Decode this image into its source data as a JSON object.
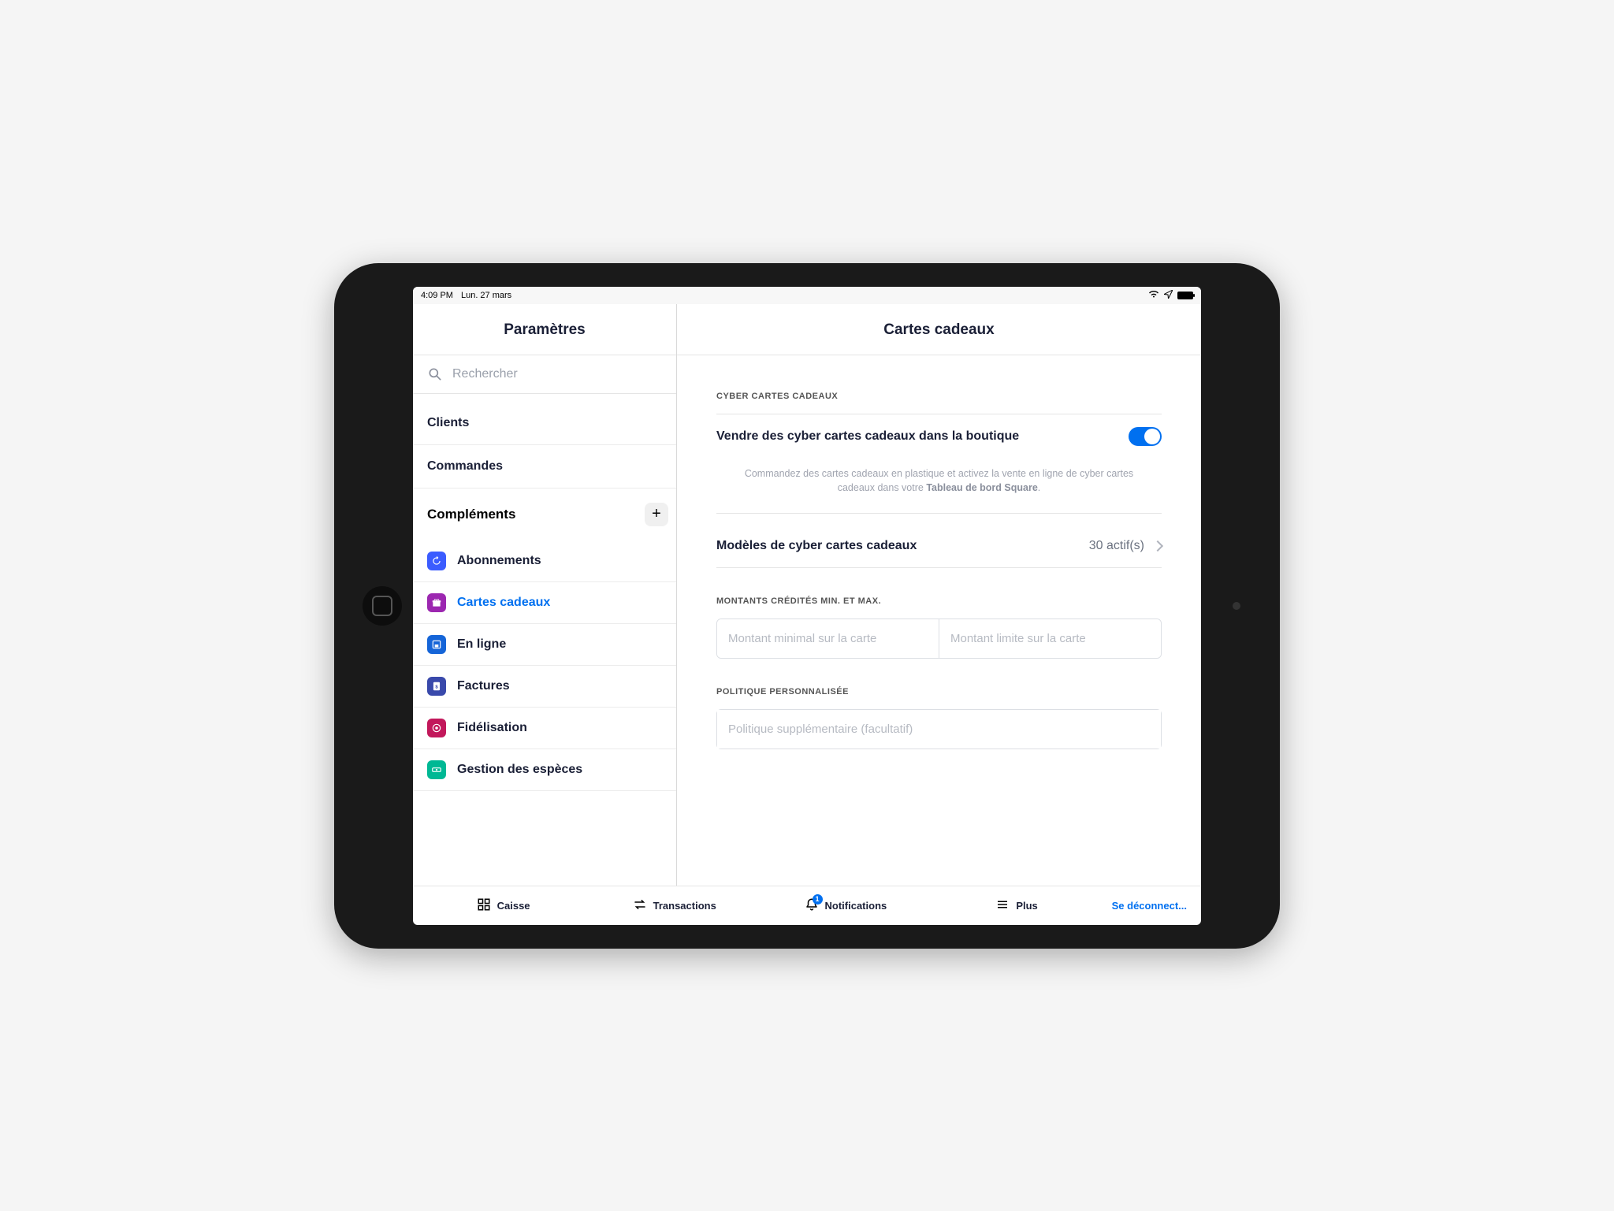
{
  "statusbar": {
    "time": "4:09 PM",
    "date": "Lun. 27 mars"
  },
  "sidebar": {
    "title": "Paramètres",
    "search_placeholder": "Rechercher",
    "top_items": [
      "Clients",
      "Commandes"
    ],
    "section": {
      "label": "Compléments"
    },
    "sub_items": [
      {
        "label": "Abonnements",
        "color": "#3b5cff",
        "icon": "refresh"
      },
      {
        "label": "Cartes cadeaux",
        "color": "#9c27b0",
        "icon": "gift",
        "active": true
      },
      {
        "label": "En ligne",
        "color": "#1565d8",
        "icon": "storefront"
      },
      {
        "label": "Factures",
        "color": "#3949ab",
        "icon": "invoice"
      },
      {
        "label": "Fidélisation",
        "color": "#c2185b",
        "icon": "loyalty"
      },
      {
        "label": "Gestion des espèces",
        "color": "#00b894",
        "icon": "cash"
      }
    ]
  },
  "main": {
    "title": "Cartes cadeaux",
    "section1_label": "CYBER CARTES CADEAUX",
    "toggle_label": "Vendre des cyber cartes cadeaux dans la boutique",
    "help_pre": "Commandez des cartes cadeaux en plastique et activez la vente en ligne de cyber cartes cadeaux dans votre ",
    "help_bold": "Tableau de bord Square",
    "models_label": "Modèles de cyber cartes cadeaux",
    "models_count": "30 actif(s)",
    "section2_label": "MONTANTS CRÉDITÉS MIN. ET MAX.",
    "min_placeholder": "Montant minimal sur la carte",
    "max_placeholder": "Montant limite sur la carte",
    "section3_label": "POLITIQUE PERSONNALISÉE",
    "policy_placeholder": "Politique supplémentaire (facultatif)"
  },
  "tabbar": {
    "caisse": "Caisse",
    "transactions": "Transactions",
    "notifications": "Notifications",
    "plus": "Plus",
    "logout": "Se déconnect...",
    "badge": "1"
  }
}
